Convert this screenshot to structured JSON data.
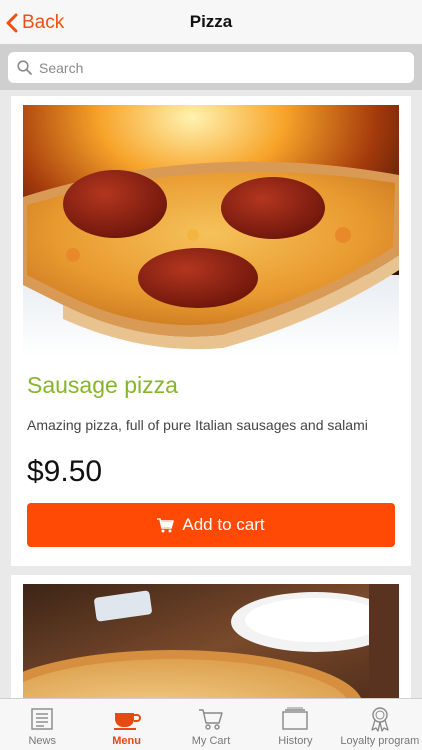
{
  "header": {
    "back_label": "Back",
    "title": "Pizza"
  },
  "search": {
    "placeholder": "Search"
  },
  "items": [
    {
      "name": "Sausage pizza",
      "description": "Amazing pizza, full of pure Italian sausages and salami",
      "price": "$9.50",
      "button_label": "Add to cart"
    }
  ],
  "tabs": [
    {
      "label": "News",
      "icon": "newspaper-icon",
      "active": false
    },
    {
      "label": "Menu",
      "icon": "cup-icon",
      "active": true
    },
    {
      "label": "My Cart",
      "icon": "cart-icon",
      "active": false
    },
    {
      "label": "History",
      "icon": "history-icon",
      "active": false
    },
    {
      "label": "Loyalty program",
      "icon": "award-ribbon-icon",
      "active": false
    }
  ],
  "colors": {
    "accent": "#ff4a05",
    "item_name": "#86b52b",
    "tab_active": "#e64a12"
  }
}
